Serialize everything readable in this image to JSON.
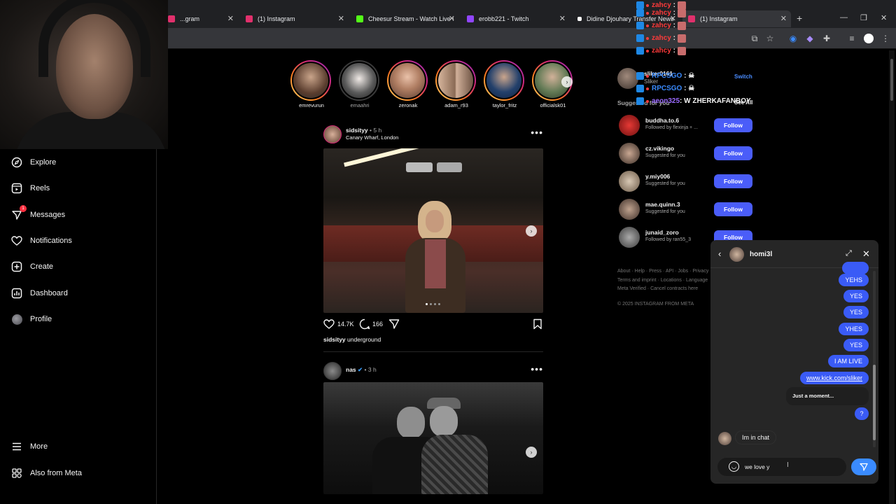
{
  "browser": {
    "tabs": [
      {
        "title": "...gram",
        "favicon_color": "#e1306c"
      },
      {
        "title": "(1) Instagram",
        "favicon_color": "#e1306c"
      },
      {
        "title": "Cheesur Stream - Watch Live o",
        "favicon_color": "#53fc18"
      },
      {
        "title": "erobb221 - Twitch",
        "favicon_color": "#9146ff"
      },
      {
        "title": "Didine Djouhary Transfer News",
        "favicon_color": "#ffffff"
      },
      {
        "title": "(1) Instagram",
        "favicon_color": "#e1306c"
      }
    ]
  },
  "nav": {
    "items": [
      {
        "label": "Explore",
        "icon": "compass-icon"
      },
      {
        "label": "Reels",
        "icon": "reels-icon"
      },
      {
        "label": "Messages",
        "icon": "messenger-icon",
        "badge": "1"
      },
      {
        "label": "Notifications",
        "icon": "heart-icon"
      },
      {
        "label": "Create",
        "icon": "plus-square-icon"
      },
      {
        "label": "Dashboard",
        "icon": "dashboard-icon"
      },
      {
        "label": "Profile",
        "icon": "avatar"
      }
    ],
    "more": "More",
    "meta": "Also from Meta"
  },
  "stories": [
    {
      "name": "emrevurun",
      "seen": false
    },
    {
      "name": "emaahri",
      "seen": true
    },
    {
      "name": "zeronak",
      "seen": false
    },
    {
      "name": "adam_r93",
      "seen": false
    },
    {
      "name": "taylor_fritz",
      "seen": false
    },
    {
      "name": "officialsk01",
      "seen": false
    }
  ],
  "posts": [
    {
      "user": "sidsityy",
      "time": "• 5 h",
      "location": "Canary Wharf, London",
      "likes": "14.7K",
      "comments": "166",
      "caption_user": "sidsityy",
      "caption": "underground"
    },
    {
      "user": "nas",
      "time": "• 3 h"
    }
  ],
  "sidebar": {
    "account_user": "sliker0161",
    "account_name": "Sliker",
    "switch": "Switch",
    "suggested_for_you": "Suggested for you",
    "see_all": "See All",
    "suggestions": [
      {
        "user": "buddha.to.6",
        "sub": "Followed by flexinja + ...",
        "btn": "Follow"
      },
      {
        "user": "cz.vikingo",
        "sub": "Suggested for you",
        "btn": "Follow"
      },
      {
        "user": "y.miy006",
        "sub": "Suggested for you",
        "btn": "Follow"
      },
      {
        "user": "mae.quinn.3",
        "sub": "Suggested for you",
        "btn": "Follow"
      },
      {
        "user": "junaid_zoro",
        "sub": "Followed by ran55_3",
        "btn": "Follow"
      }
    ],
    "footer1": "About · Help · Press · API · Jobs · Privacy",
    "footer2": "Terms and imprint · Locations · Language",
    "footer3": "Meta Verified · Cancel contracts here",
    "copyright": "© 2025 INSTAGRAM FROM META"
  },
  "chat_overlay": [
    {
      "user": "zahcy",
      "msg": ":",
      "color": "#ff3b3b"
    },
    {
      "user": "zahcy",
      "msg": ":",
      "color": "#ff3b3b"
    },
    {
      "user": "zahcy",
      "msg": ":",
      "color": "#ff3b3b"
    },
    {
      "user": "zahcy",
      "msg": ":",
      "color": "#ff3b3b"
    },
    {
      "user": "zahcy",
      "msg": ":",
      "color": "#ff3b3b"
    },
    {
      "user": "RPCSGO",
      "msg": ":",
      "color": "#3a8bff"
    },
    {
      "user": "RPCSGO",
      "msg": ":",
      "color": "#3a8bff"
    },
    {
      "user": "aeon325",
      "msg": ": W ZHERKAFANBOY",
      "color": "#9b6bff"
    }
  ],
  "dm": {
    "title": "homi3l",
    "sent": [
      "YEHS",
      "YES",
      "YES",
      "YHES",
      "YES",
      "I AM LIVE",
      "www.kick.com/sliker"
    ],
    "status": "Just a moment...",
    "last_sent": "?",
    "received": "Im in chat",
    "input_value": "we love y"
  }
}
